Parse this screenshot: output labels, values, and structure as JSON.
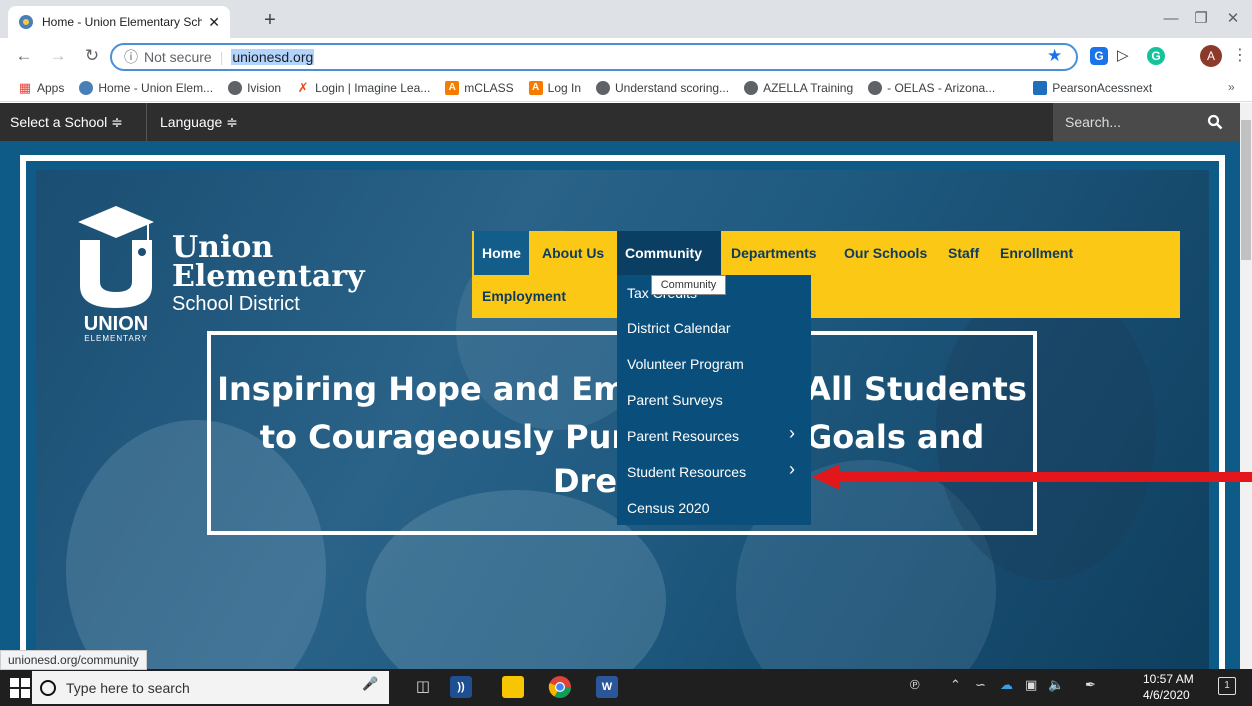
{
  "browser": {
    "tab_title": "Home - Union Elementary Schoo",
    "tab_close": "✕",
    "new_tab": "+",
    "address_secure": "Not secure",
    "address_url": "unionesd.org",
    "avatar_letter": "A",
    "extensions": [
      "G",
      "G"
    ],
    "bookmarks": [
      {
        "label": "Apps",
        "icon": "apps-grid-icon",
        "color": "#e94235"
      },
      {
        "label": "Home - Union Elem...",
        "icon": "chrome-icon",
        "color": "#4285f4"
      },
      {
        "label": "Ivision",
        "icon": "globe-icon",
        "color": "#5f6368"
      },
      {
        "label": "Login | Imagine Lea...",
        "icon": "imagine-learning-icon",
        "color": "#e84c1a"
      },
      {
        "label": "mCLASS",
        "icon": "amplify-icon",
        "color": "#f57c00"
      },
      {
        "label": "Log In",
        "icon": "amplify-icon",
        "color": "#f57c00"
      },
      {
        "label": "Understand scoring...",
        "icon": "globe-icon",
        "color": "#5f6368"
      },
      {
        "label": "AZELLA Training",
        "icon": "globe-icon",
        "color": "#5f6368"
      },
      {
        "label": "- OELAS - Arizona...",
        "icon": "globe-icon",
        "color": "#5f6368"
      },
      {
        "label": "PearsonAcessnext",
        "icon": "pearson-icon",
        "color": "#1f6fbd"
      }
    ],
    "bookmarks_more": "»",
    "status_link": "unionesd.org/community"
  },
  "site": {
    "select_school": "Select a School ≑",
    "language": "Language ≑",
    "search_placeholder": "Search...",
    "logo_line1": "Union",
    "logo_line2": "Elementary",
    "logo_line3": "School District",
    "nav": {
      "home": "Home",
      "about": "About Us",
      "community": "Community",
      "departments": "Departments",
      "our_schools": "Our Schools",
      "staff": "Staff",
      "enrollment": "Enrollment",
      "employment": "Employment"
    },
    "tooltip": "Community",
    "dropdown": [
      {
        "label": "Tax Credits",
        "has_sub": false
      },
      {
        "label": "District Calendar",
        "has_sub": false
      },
      {
        "label": "Volunteer Program",
        "has_sub": false
      },
      {
        "label": "Parent Surveys",
        "has_sub": false
      },
      {
        "label": "Parent Resources",
        "has_sub": true
      },
      {
        "label": "Student Resources",
        "has_sub": true
      },
      {
        "label": "Census 2020",
        "has_sub": false
      }
    ],
    "banner_line1": "Inspiring Hope and Empowering All Students",
    "banner_line2": "to Courageously Pursue Their Goals and",
    "banner_line3": "Dreams",
    "accent_yellow": "#fbc815",
    "accent_blue": "#0d5b86",
    "arrow_color": "#e3161b"
  },
  "taskbar": {
    "search_placeholder": "Type here to search",
    "time": "10:57 AM",
    "date": "4/6/2020",
    "notification_count": "1"
  }
}
